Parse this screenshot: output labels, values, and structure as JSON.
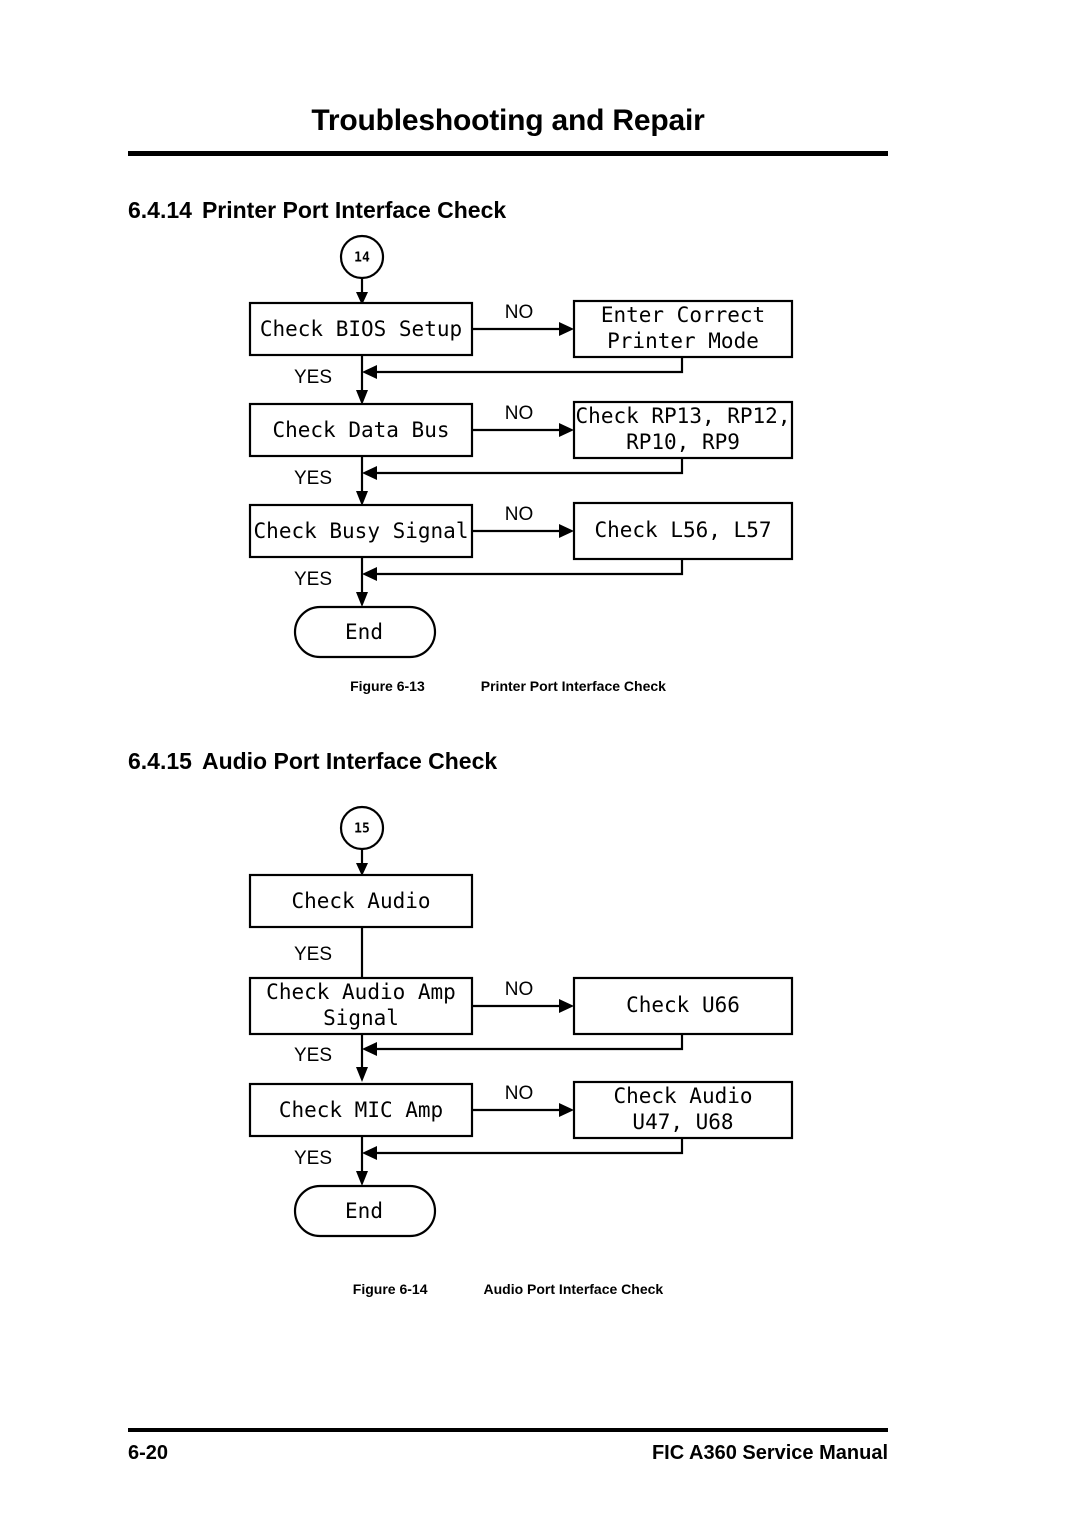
{
  "header": {
    "title": "Troubleshooting and Repair"
  },
  "sections": [
    {
      "number": "6.4.14",
      "title": "Printer Port Interface Check",
      "figure": {
        "number": "Figure 6-13",
        "title": "Printer Port Interface Check"
      }
    },
    {
      "number": "6.4.15",
      "title": "Audio Port Interface Check",
      "figure": {
        "number": "Figure 6-14",
        "title": "Audio Port Interface Check"
      }
    }
  ],
  "footer": {
    "page_number": "6-20",
    "manual": "FIC A360 Service Manual"
  },
  "chart_data": [
    {
      "type": "diagram",
      "id": "printer-port-interface-check",
      "title": "Printer Port Interface Check",
      "connector_label": "14",
      "nodes": [
        {
          "id": "n0",
          "shape": "circle",
          "text": "14"
        },
        {
          "id": "n1",
          "shape": "process",
          "text": "Check BIOS Setup"
        },
        {
          "id": "n2",
          "shape": "process",
          "text": "Enter Correct\nPrinter Mode",
          "lines": [
            "Enter Correct",
            "Printer Mode"
          ]
        },
        {
          "id": "n3",
          "shape": "process",
          "text": "Check Data Bus"
        },
        {
          "id": "n4",
          "shape": "process",
          "text": "Check RP13, RP12,\nRP10, RP9",
          "lines": [
            "Check RP13, RP12,",
            "RP10, RP9"
          ]
        },
        {
          "id": "n5",
          "shape": "process",
          "text": "Check Busy Signal"
        },
        {
          "id": "n6",
          "shape": "process",
          "text": "Check L56, L57",
          "lines": [
            "Check L56, L57"
          ]
        },
        {
          "id": "n7",
          "shape": "terminator",
          "text": "End"
        }
      ],
      "edges": [
        {
          "from": "n0",
          "to": "n1",
          "label": ""
        },
        {
          "from": "n1",
          "to": "n2",
          "label": "NO"
        },
        {
          "from": "n1",
          "to": "n3",
          "label": "YES"
        },
        {
          "from": "n2",
          "to": "n3",
          "label": ""
        },
        {
          "from": "n3",
          "to": "n4",
          "label": "NO"
        },
        {
          "from": "n3",
          "to": "n5",
          "label": "YES"
        },
        {
          "from": "n4",
          "to": "n5",
          "label": ""
        },
        {
          "from": "n5",
          "to": "n6",
          "label": "NO"
        },
        {
          "from": "n5",
          "to": "n7",
          "label": "YES"
        },
        {
          "from": "n6",
          "to": "n7",
          "label": ""
        }
      ]
    },
    {
      "type": "diagram",
      "id": "audio-port-interface-check",
      "title": "Audio Port Interface Check",
      "connector_label": "15",
      "nodes": [
        {
          "id": "m0",
          "shape": "circle",
          "text": "15"
        },
        {
          "id": "m1",
          "shape": "process",
          "text": "Check Audio"
        },
        {
          "id": "m2",
          "shape": "process",
          "text": "Check Audio Amp\nSignal",
          "lines": [
            "Check Audio Amp",
            "Signal"
          ]
        },
        {
          "id": "m3",
          "shape": "process",
          "text": "Check U66",
          "lines": [
            "Check U66"
          ]
        },
        {
          "id": "m4",
          "shape": "process",
          "text": "Check MIC Amp"
        },
        {
          "id": "m5",
          "shape": "process",
          "text": "Check Audio\nU47, U68",
          "lines": [
            "Check Audio",
            "U47, U68"
          ]
        },
        {
          "id": "m6",
          "shape": "terminator",
          "text": "End"
        }
      ],
      "edges": [
        {
          "from": "m0",
          "to": "m1",
          "label": ""
        },
        {
          "from": "m1",
          "to": "m2",
          "label": "YES"
        },
        {
          "from": "m2",
          "to": "m3",
          "label": "NO"
        },
        {
          "from": "m2",
          "to": "m4",
          "label": "YES"
        },
        {
          "from": "m3",
          "to": "m4",
          "label": ""
        },
        {
          "from": "m4",
          "to": "m5",
          "label": "NO"
        },
        {
          "from": "m4",
          "to": "m6",
          "label": "YES"
        },
        {
          "from": "m5",
          "to": "m6",
          "label": ""
        }
      ]
    }
  ],
  "flow1": {
    "connector": "14",
    "box1": "Check BIOS Setup",
    "box2_line1": "Enter Correct",
    "box2_line2": "Printer Mode",
    "box3": "Check Data Bus",
    "box4_line1": "Check RP13, RP12,",
    "box4_line2": "RP10, RP9",
    "box5": "Check Busy Signal",
    "box6": "Check L56, L57",
    "end": "End",
    "no1": "NO",
    "no2": "NO",
    "no3": "NO",
    "yes1": "YES",
    "yes2": "YES",
    "yes3": "YES"
  },
  "flow2": {
    "connector": "15",
    "box1": "Check Audio",
    "box2_line1": "Check Audio Amp",
    "box2_line2": "Signal",
    "box3": "Check U66",
    "box4": "Check MIC Amp",
    "box5_line1": "Check Audio",
    "box5_line2": "U47, U68",
    "end": "End",
    "no1": "NO",
    "no2": "NO",
    "yes1": "YES",
    "yes2": "YES",
    "yes3": "YES"
  }
}
